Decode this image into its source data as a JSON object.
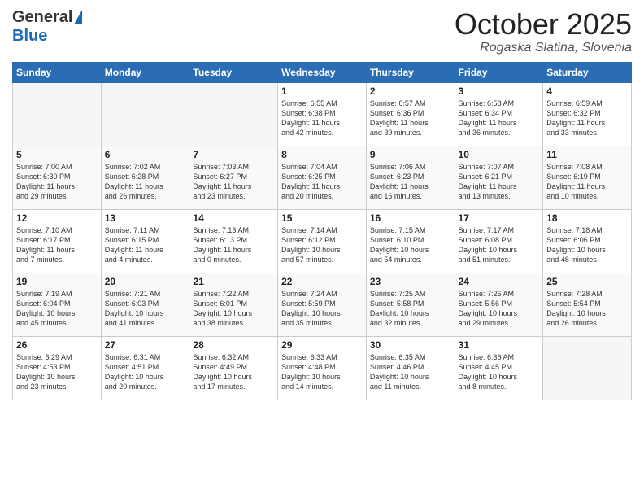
{
  "header": {
    "logo_general": "General",
    "logo_blue": "Blue",
    "month_title": "October 2025",
    "location": "Rogaska Slatina, Slovenia"
  },
  "days_of_week": [
    "Sunday",
    "Monday",
    "Tuesday",
    "Wednesday",
    "Thursday",
    "Friday",
    "Saturday"
  ],
  "weeks": [
    [
      {
        "day": "",
        "info": ""
      },
      {
        "day": "",
        "info": ""
      },
      {
        "day": "",
        "info": ""
      },
      {
        "day": "1",
        "info": "Sunrise: 6:55 AM\nSunset: 6:38 PM\nDaylight: 11 hours\nand 42 minutes."
      },
      {
        "day": "2",
        "info": "Sunrise: 6:57 AM\nSunset: 6:36 PM\nDaylight: 11 hours\nand 39 minutes."
      },
      {
        "day": "3",
        "info": "Sunrise: 6:58 AM\nSunset: 6:34 PM\nDaylight: 11 hours\nand 36 minutes."
      },
      {
        "day": "4",
        "info": "Sunrise: 6:59 AM\nSunset: 6:32 PM\nDaylight: 11 hours\nand 33 minutes."
      }
    ],
    [
      {
        "day": "5",
        "info": "Sunrise: 7:00 AM\nSunset: 6:30 PM\nDaylight: 11 hours\nand 29 minutes."
      },
      {
        "day": "6",
        "info": "Sunrise: 7:02 AM\nSunset: 6:28 PM\nDaylight: 11 hours\nand 26 minutes."
      },
      {
        "day": "7",
        "info": "Sunrise: 7:03 AM\nSunset: 6:27 PM\nDaylight: 11 hours\nand 23 minutes."
      },
      {
        "day": "8",
        "info": "Sunrise: 7:04 AM\nSunset: 6:25 PM\nDaylight: 11 hours\nand 20 minutes."
      },
      {
        "day": "9",
        "info": "Sunrise: 7:06 AM\nSunset: 6:23 PM\nDaylight: 11 hours\nand 16 minutes."
      },
      {
        "day": "10",
        "info": "Sunrise: 7:07 AM\nSunset: 6:21 PM\nDaylight: 11 hours\nand 13 minutes."
      },
      {
        "day": "11",
        "info": "Sunrise: 7:08 AM\nSunset: 6:19 PM\nDaylight: 11 hours\nand 10 minutes."
      }
    ],
    [
      {
        "day": "12",
        "info": "Sunrise: 7:10 AM\nSunset: 6:17 PM\nDaylight: 11 hours\nand 7 minutes."
      },
      {
        "day": "13",
        "info": "Sunrise: 7:11 AM\nSunset: 6:15 PM\nDaylight: 11 hours\nand 4 minutes."
      },
      {
        "day": "14",
        "info": "Sunrise: 7:13 AM\nSunset: 6:13 PM\nDaylight: 11 hours\nand 0 minutes."
      },
      {
        "day": "15",
        "info": "Sunrise: 7:14 AM\nSunset: 6:12 PM\nDaylight: 10 hours\nand 57 minutes."
      },
      {
        "day": "16",
        "info": "Sunrise: 7:15 AM\nSunset: 6:10 PM\nDaylight: 10 hours\nand 54 minutes."
      },
      {
        "day": "17",
        "info": "Sunrise: 7:17 AM\nSunset: 6:08 PM\nDaylight: 10 hours\nand 51 minutes."
      },
      {
        "day": "18",
        "info": "Sunrise: 7:18 AM\nSunset: 6:06 PM\nDaylight: 10 hours\nand 48 minutes."
      }
    ],
    [
      {
        "day": "19",
        "info": "Sunrise: 7:19 AM\nSunset: 6:04 PM\nDaylight: 10 hours\nand 45 minutes."
      },
      {
        "day": "20",
        "info": "Sunrise: 7:21 AM\nSunset: 6:03 PM\nDaylight: 10 hours\nand 41 minutes."
      },
      {
        "day": "21",
        "info": "Sunrise: 7:22 AM\nSunset: 6:01 PM\nDaylight: 10 hours\nand 38 minutes."
      },
      {
        "day": "22",
        "info": "Sunrise: 7:24 AM\nSunset: 5:59 PM\nDaylight: 10 hours\nand 35 minutes."
      },
      {
        "day": "23",
        "info": "Sunrise: 7:25 AM\nSunset: 5:58 PM\nDaylight: 10 hours\nand 32 minutes."
      },
      {
        "day": "24",
        "info": "Sunrise: 7:26 AM\nSunset: 5:56 PM\nDaylight: 10 hours\nand 29 minutes."
      },
      {
        "day": "25",
        "info": "Sunrise: 7:28 AM\nSunset: 5:54 PM\nDaylight: 10 hours\nand 26 minutes."
      }
    ],
    [
      {
        "day": "26",
        "info": "Sunrise: 6:29 AM\nSunset: 4:53 PM\nDaylight: 10 hours\nand 23 minutes."
      },
      {
        "day": "27",
        "info": "Sunrise: 6:31 AM\nSunset: 4:51 PM\nDaylight: 10 hours\nand 20 minutes."
      },
      {
        "day": "28",
        "info": "Sunrise: 6:32 AM\nSunset: 4:49 PM\nDaylight: 10 hours\nand 17 minutes."
      },
      {
        "day": "29",
        "info": "Sunrise: 6:33 AM\nSunset: 4:48 PM\nDaylight: 10 hours\nand 14 minutes."
      },
      {
        "day": "30",
        "info": "Sunrise: 6:35 AM\nSunset: 4:46 PM\nDaylight: 10 hours\nand 11 minutes."
      },
      {
        "day": "31",
        "info": "Sunrise: 6:36 AM\nSunset: 4:45 PM\nDaylight: 10 hours\nand 8 minutes."
      },
      {
        "day": "",
        "info": ""
      }
    ]
  ]
}
